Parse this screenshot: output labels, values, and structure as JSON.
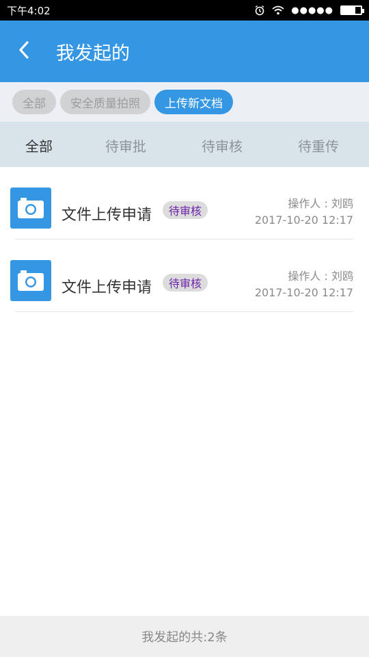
{
  "status_bar": {
    "time": "下午4:02",
    "icons": [
      "alarm-icon",
      "wifi-icon",
      "signal-icon",
      "battery-icon"
    ],
    "signal_text": "●●●●●"
  },
  "header": {
    "back_icon": "chevron-left-icon",
    "title": "我发起的",
    "bg_color": "#3597e3"
  },
  "chips": [
    {
      "label": "全部",
      "active": false
    },
    {
      "label": "安全质量拍照",
      "active": false
    },
    {
      "label": "上传新文档",
      "active": true
    }
  ],
  "tabs": [
    {
      "label": "全部",
      "active": true
    },
    {
      "label": "待审批",
      "active": false
    },
    {
      "label": "待审核",
      "active": false
    },
    {
      "label": "待重传",
      "active": false
    }
  ],
  "items": [
    {
      "icon": "camera-icon",
      "title": "文件上传申请",
      "badge": "待审核",
      "operator": "操作人 : 刘鸥",
      "time": "2017-10-20 12:17"
    },
    {
      "icon": "camera-icon",
      "title": "文件上传申请",
      "badge": "待审核",
      "operator": "操作人 : 刘鸥",
      "time": "2017-10-20 12:17"
    }
  ],
  "footer": {
    "summary": "我发起的共:2条"
  }
}
